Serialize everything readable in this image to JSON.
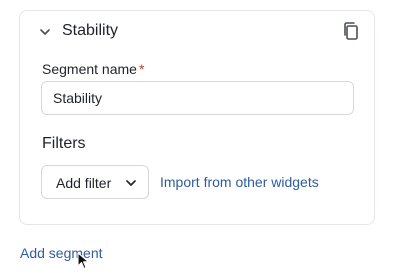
{
  "segment": {
    "title": "Stability",
    "icons": {
      "collapse": "chevron-down-icon",
      "copy": "copy-icon"
    },
    "name_label": "Segment name",
    "required_mark": "*",
    "name_value": "Stability"
  },
  "filters": {
    "heading": "Filters",
    "add_filter_label": "Add filter",
    "import_link": "Import from other widgets"
  },
  "footer": {
    "add_segment_label": "Add segment"
  },
  "colors": {
    "link": "#2f5d9a",
    "required": "#c0392b",
    "border": "#e3e6ea"
  }
}
